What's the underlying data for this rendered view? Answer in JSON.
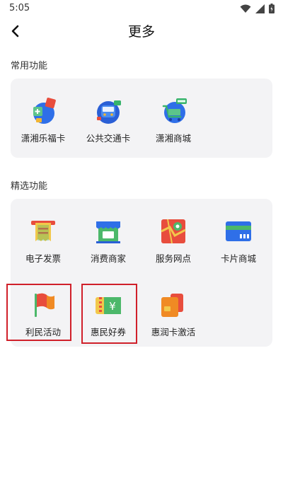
{
  "status": {
    "time": "5:05"
  },
  "header": {
    "title": "更多"
  },
  "sections": {
    "common": {
      "title": "常用功能",
      "items": [
        {
          "label": "潇湘乐福卡",
          "icon": "card-gift-icon"
        },
        {
          "label": "公共交通卡",
          "icon": "bus-card-icon"
        },
        {
          "label": "潇湘商城",
          "icon": "shop-cart-icon"
        }
      ]
    },
    "featured": {
      "title": "精选功能",
      "items": [
        {
          "label": "电子发票",
          "icon": "invoice-icon"
        },
        {
          "label": "消费商家",
          "icon": "store-icon"
        },
        {
          "label": "服务网点",
          "icon": "map-icon"
        },
        {
          "label": "卡片商城",
          "icon": "card-shop-icon"
        },
        {
          "label": "利民活动",
          "icon": "flag-icon"
        },
        {
          "label": "惠民好券",
          "icon": "coupon-icon"
        },
        {
          "label": "惠润卡激活",
          "icon": "card-activate-icon"
        }
      ]
    }
  },
  "colors": {
    "highlight": "#d0202a",
    "card_bg": "#f3f3f5"
  }
}
